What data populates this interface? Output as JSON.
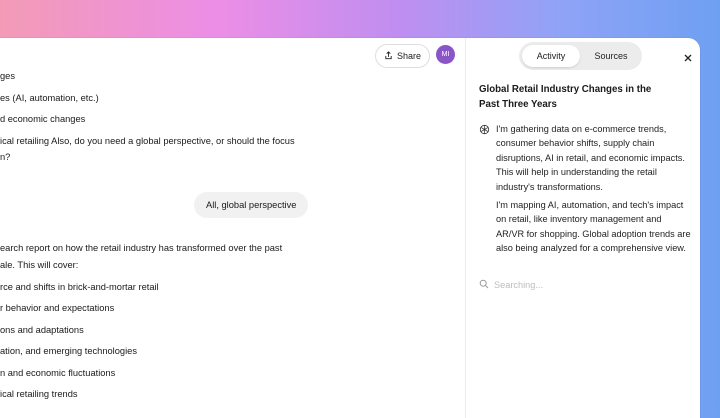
{
  "header": {
    "share_label": "Share",
    "avatar_initials": "MI"
  },
  "chat": {
    "lines_top": [
      "ges",
      "es (AI, automation, etc.)",
      "d economic changes",
      "ical retailing Also, do you need a global perspective, or should the focus",
      "n?"
    ],
    "user_message": "All, global perspective",
    "lines_bottom": [
      "earch report on how the retail industry has transformed over the past",
      "ale. This will cover:",
      "rce and shifts in brick-and-mortar retail",
      "r behavior and expectations",
      "ons and adaptations",
      "ation, and emerging technologies",
      "n and economic fluctuations",
      "ical retailing trends"
    ]
  },
  "panel": {
    "tabs": [
      {
        "label": "Activity"
      },
      {
        "label": "Sources"
      }
    ],
    "title": "Global Retail Industry Changes in the Past Three Years",
    "paragraphs": [
      "I'm gathering data on e-commerce trends, consumer behavior shifts, supply chain disruptions, AI in retail, and economic impacts. This will help in understanding the retail industry's transformations.",
      "I'm mapping AI, automation, and tech's impact on retail, like inventory management and AR/VR for shopping. Global adoption trends are also being analyzed for a comprehensive view."
    ],
    "status": "Searching..."
  },
  "colors": {
    "avatar_bg": "#8a56c7",
    "bubble_bg": "#f1f1f1",
    "segment_bg": "#ececec"
  }
}
